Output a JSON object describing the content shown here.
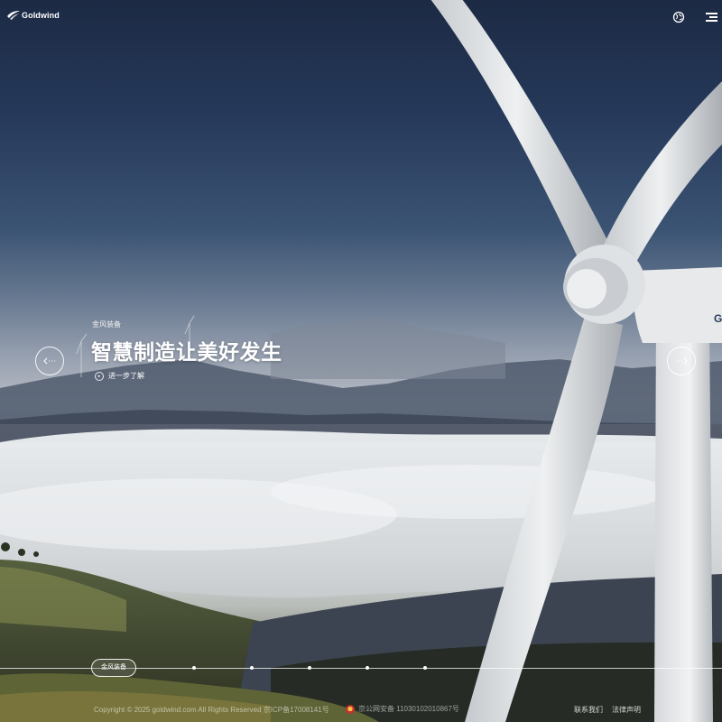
{
  "header": {
    "logo_text": "Goldwind",
    "language_icon": "globe-icon",
    "menu_icon": "hamburger-menu-icon"
  },
  "hero": {
    "eyebrow": "金风装备",
    "headline": "智慧制造让美好发生",
    "learn_more": "进一步了解",
    "learn_more_icon": "play-circle-icon",
    "prev_icon": "arrow-left-icon",
    "next_icon": "arrow-right-icon",
    "turbine_brand": "G"
  },
  "timeline": {
    "active_label": "金风装备",
    "dot_count": 5
  },
  "footer": {
    "copyright": "Copyright © 2025 goldwind.com All Rights Reserved   京ICP备17008141号",
    "police_record": "京公网安备 11030102010867号",
    "links": [
      "联系我们",
      "法律声明"
    ]
  },
  "colors": {
    "sky_top": "#1c2a44",
    "mist": "#dfe3e6",
    "turbine": "#e6e8ea"
  }
}
